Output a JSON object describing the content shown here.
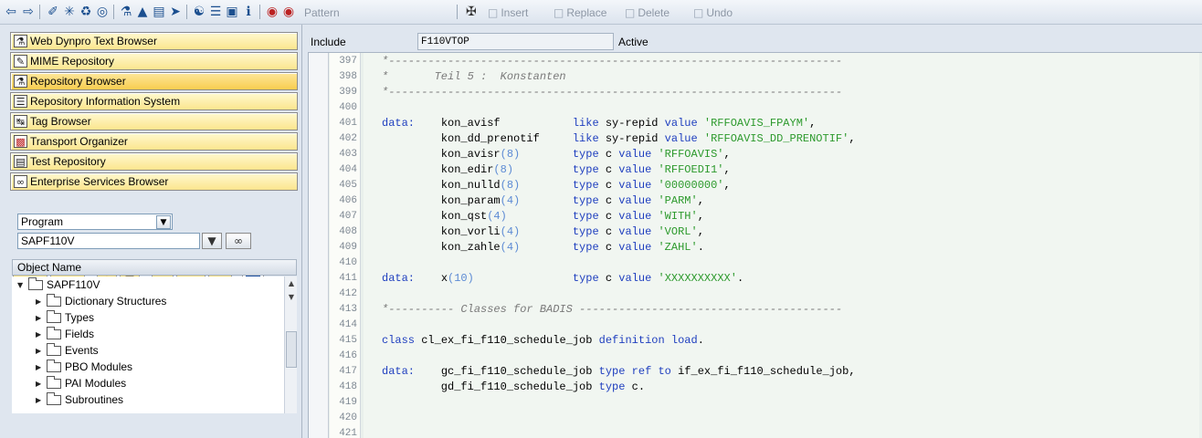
{
  "toolbar": {
    "pattern_label": "Pattern",
    "insert_label": "Insert",
    "replace_label": "Replace",
    "delete_label": "Delete",
    "undo_label": "Undo"
  },
  "nav": {
    "items": [
      {
        "label": "Web Dynpro Text Browser",
        "icon": "web-dynpro-icon"
      },
      {
        "label": "MIME Repository",
        "icon": "mime-icon"
      },
      {
        "label": "Repository Browser",
        "icon": "hierarchy-icon",
        "active": true
      },
      {
        "label": "Repository Information System",
        "icon": "info-system-icon"
      },
      {
        "label": "Tag Browser",
        "icon": "tag-icon"
      },
      {
        "label": "Transport Organizer",
        "icon": "truck-icon"
      },
      {
        "label": "Test Repository",
        "icon": "test-icon"
      },
      {
        "label": "Enterprise Services Browser",
        "icon": "services-icon"
      }
    ],
    "object_type": "Program",
    "object_name": "SAPF110V"
  },
  "tree": {
    "header": "Object Name",
    "root": "SAPF110V",
    "children": [
      "Dictionary Structures",
      "Types",
      "Fields",
      "Events",
      "PBO Modules",
      "PAI Modules",
      "Subroutines"
    ]
  },
  "editor": {
    "include_label": "Include",
    "include_name": "F110VTOP",
    "status": "Active",
    "lines": [
      {
        "n": "397",
        "parts": [
          [
            "cmt",
            "*---------------------------------------------------------------------"
          ]
        ]
      },
      {
        "n": "398",
        "parts": [
          [
            "cmt",
            "*       Teil 5 :  Konstanten"
          ]
        ]
      },
      {
        "n": "399",
        "parts": [
          [
            "cmt",
            "*---------------------------------------------------------------------"
          ]
        ]
      },
      {
        "n": "400",
        "parts": []
      },
      {
        "n": "401",
        "parts": [
          [
            "kw",
            "data:"
          ],
          [
            "",
            "    kon_avisf           "
          ],
          [
            "kw",
            "like"
          ],
          [
            "",
            " sy-repid "
          ],
          [
            "kw",
            "value"
          ],
          [
            "",
            " "
          ],
          [
            "str",
            "'RFFOAVIS_FPAYM'"
          ],
          [
            "",
            ","
          ]
        ]
      },
      {
        "n": "402",
        "parts": [
          [
            "",
            "         kon_dd_prenotif     "
          ],
          [
            "kw",
            "like"
          ],
          [
            "",
            " sy-repid "
          ],
          [
            "kw",
            "value"
          ],
          [
            "",
            " "
          ],
          [
            "str",
            "'RFFOAVIS_DD_PRENOTIF'"
          ],
          [
            "",
            ","
          ]
        ]
      },
      {
        "n": "403",
        "parts": [
          [
            "",
            "         kon_avisr"
          ],
          [
            "num",
            "(8)"
          ],
          [
            "",
            "        "
          ],
          [
            "kw",
            "type"
          ],
          [
            "",
            " c "
          ],
          [
            "kw",
            "value"
          ],
          [
            "",
            " "
          ],
          [
            "str",
            "'RFFOAVIS'"
          ],
          [
            "",
            ","
          ]
        ]
      },
      {
        "n": "404",
        "parts": [
          [
            "",
            "         kon_edir"
          ],
          [
            "num",
            "(8)"
          ],
          [
            "",
            "         "
          ],
          [
            "kw",
            "type"
          ],
          [
            "",
            " c "
          ],
          [
            "kw",
            "value"
          ],
          [
            "",
            " "
          ],
          [
            "str",
            "'RFFOEDI1'"
          ],
          [
            "",
            ","
          ]
        ]
      },
      {
        "n": "405",
        "parts": [
          [
            "",
            "         kon_nulld"
          ],
          [
            "num",
            "(8)"
          ],
          [
            "",
            "        "
          ],
          [
            "kw",
            "type"
          ],
          [
            "",
            " c "
          ],
          [
            "kw",
            "value"
          ],
          [
            "",
            " "
          ],
          [
            "str",
            "'00000000'"
          ],
          [
            "",
            ","
          ]
        ]
      },
      {
        "n": "406",
        "parts": [
          [
            "",
            "         kon_param"
          ],
          [
            "num",
            "(4)"
          ],
          [
            "",
            "        "
          ],
          [
            "kw",
            "type"
          ],
          [
            "",
            " c "
          ],
          [
            "kw",
            "value"
          ],
          [
            "",
            " "
          ],
          [
            "str",
            "'PARM'"
          ],
          [
            "",
            ","
          ]
        ]
      },
      {
        "n": "407",
        "parts": [
          [
            "",
            "         kon_qst"
          ],
          [
            "num",
            "(4)"
          ],
          [
            "",
            "          "
          ],
          [
            "kw",
            "type"
          ],
          [
            "",
            " c "
          ],
          [
            "kw",
            "value"
          ],
          [
            "",
            " "
          ],
          [
            "str",
            "'WITH'"
          ],
          [
            "",
            ","
          ]
        ]
      },
      {
        "n": "408",
        "parts": [
          [
            "",
            "         kon_vorli"
          ],
          [
            "num",
            "(4)"
          ],
          [
            "",
            "        "
          ],
          [
            "kw",
            "type"
          ],
          [
            "",
            " c "
          ],
          [
            "kw",
            "value"
          ],
          [
            "",
            " "
          ],
          [
            "str",
            "'VORL'"
          ],
          [
            "",
            ","
          ]
        ]
      },
      {
        "n": "409",
        "parts": [
          [
            "",
            "         kon_zahle"
          ],
          [
            "num",
            "(4)"
          ],
          [
            "",
            "        "
          ],
          [
            "kw",
            "type"
          ],
          [
            "",
            " c "
          ],
          [
            "kw",
            "value"
          ],
          [
            "",
            " "
          ],
          [
            "str",
            "'ZAHL'"
          ],
          [
            "",
            "."
          ]
        ]
      },
      {
        "n": "410",
        "parts": []
      },
      {
        "n": "411",
        "parts": [
          [
            "kw",
            "data:"
          ],
          [
            "",
            "    x"
          ],
          [
            "num",
            "(10)"
          ],
          [
            "",
            "               "
          ],
          [
            "kw",
            "type"
          ],
          [
            "",
            " c "
          ],
          [
            "kw",
            "value"
          ],
          [
            "",
            " "
          ],
          [
            "str",
            "'XXXXXXXXXX'"
          ],
          [
            "",
            "."
          ]
        ]
      },
      {
        "n": "412",
        "parts": []
      },
      {
        "n": "413",
        "parts": [
          [
            "cmt",
            "*---------- Classes for BADIS ----------------------------------------"
          ]
        ]
      },
      {
        "n": "414",
        "parts": []
      },
      {
        "n": "415",
        "parts": [
          [
            "kw",
            "class"
          ],
          [
            "",
            " cl_ex_fi_f110_schedule_job "
          ],
          [
            "kw",
            "definition"
          ],
          [
            "",
            " "
          ],
          [
            "kw",
            "load"
          ],
          [
            "",
            "."
          ]
        ]
      },
      {
        "n": "416",
        "parts": []
      },
      {
        "n": "417",
        "parts": [
          [
            "kw",
            "data:"
          ],
          [
            "",
            "    gc_fi_f110_schedule_job "
          ],
          [
            "kw",
            "type"
          ],
          [
            "",
            " "
          ],
          [
            "kw",
            "ref"
          ],
          [
            "",
            " "
          ],
          [
            "kw",
            "to"
          ],
          [
            "",
            " if_ex_fi_f110_schedule_job,"
          ]
        ]
      },
      {
        "n": "418",
        "parts": [
          [
            "",
            "         gd_fi_f110_schedule_job "
          ],
          [
            "kw",
            "type"
          ],
          [
            "",
            " c."
          ]
        ]
      },
      {
        "n": "419",
        "parts": []
      },
      {
        "n": "420",
        "parts": []
      },
      {
        "n": "421",
        "parts": []
      }
    ]
  }
}
